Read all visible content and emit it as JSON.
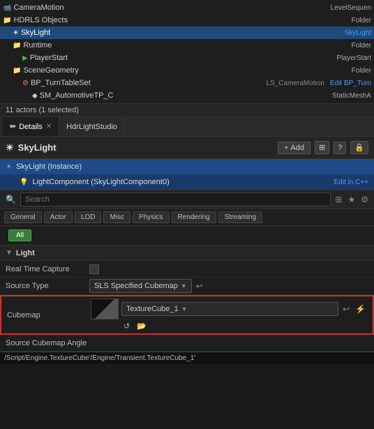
{
  "scene": {
    "items": [
      {
        "indent": 0,
        "icon": "📹",
        "label": "CameraMotion",
        "rightLabel": "LevelSequen",
        "rightClass": "",
        "selected": false
      },
      {
        "indent": 0,
        "icon": "📁",
        "label": "HDRLS Objects",
        "rightLabel": "Folder",
        "rightClass": "",
        "selected": false
      },
      {
        "indent": 1,
        "icon": "☀",
        "label": "SkyLight",
        "rightLabel": "SkyLight",
        "rightClass": "blue",
        "selected": true
      },
      {
        "indent": 1,
        "icon": "📁",
        "label": "Runtime",
        "rightLabel": "Folder",
        "rightClass": "",
        "selected": false
      },
      {
        "indent": 2,
        "icon": "▶",
        "label": "PlayerStart",
        "rightLabel": "PlayerStart",
        "rightClass": "",
        "selected": false
      },
      {
        "indent": 1,
        "icon": "📁",
        "label": "SceneGeometry",
        "rightLabel": "Folder",
        "rightClass": "",
        "selected": false
      },
      {
        "indent": 2,
        "icon": "⚙",
        "label": "BP_TurnTableSet",
        "rightLabel2": "LS_CameraMotion",
        "rightLabel": "Edit BP_Turn",
        "rightClass": "blue",
        "selected": false
      },
      {
        "indent": 3,
        "icon": "◆",
        "label": "SM_AutomotiveTP_C",
        "rightLabel": "StaticMeshA",
        "rightClass": "",
        "selected": false
      }
    ],
    "actors_count": "11 actors (1 selected)"
  },
  "tabs": [
    {
      "id": "details",
      "label": "Details",
      "icon": "✏",
      "active": true,
      "closeable": true
    },
    {
      "id": "hdrlightstudio",
      "label": "HdrLightStudio",
      "icon": "",
      "active": false,
      "closeable": false
    }
  ],
  "component": {
    "title": "SkyLight",
    "icon": "☀",
    "add_label": "+ Add",
    "actions": [
      "⊞",
      "?",
      "🔒"
    ]
  },
  "component_list": [
    {
      "icon": "☀",
      "label": "SkyLight (Instance)",
      "selected": true
    },
    {
      "icon": "💡",
      "label": "LightComponent (SkyLightComponent0)",
      "right": "Edit in C++",
      "selected": false
    }
  ],
  "search": {
    "placeholder": "Search"
  },
  "categories": [
    {
      "id": "general",
      "label": "General",
      "active": false
    },
    {
      "id": "actor",
      "label": "Actor",
      "active": false
    },
    {
      "id": "lod",
      "label": "LOD",
      "active": false
    },
    {
      "id": "misc",
      "label": "Misc",
      "active": false
    },
    {
      "id": "physics",
      "label": "Physics",
      "active": false
    },
    {
      "id": "rendering",
      "label": "Rendering",
      "active": false
    },
    {
      "id": "streaming",
      "label": "Streaming",
      "active": false
    }
  ],
  "all_label": "All",
  "sections": {
    "light": {
      "title": "Light",
      "properties": [
        {
          "id": "realtime",
          "label": "Real Time Capture",
          "type": "checkbox",
          "value": false
        },
        {
          "id": "sourcetype",
          "label": "Source Type",
          "type": "dropdown",
          "value": "SLS Specified Cubemap",
          "hasReset": true
        },
        {
          "id": "cubemap",
          "label": "Cubemap",
          "type": "cubemap",
          "value": "TextureCube_1",
          "hasReset": true,
          "highlighted": true
        }
      ]
    }
  },
  "source_cubemap_angle": {
    "label": "Source Cubemap Angle"
  },
  "path_bar": {
    "text": "/Script/Engine.TextureCube'/Engine/Transient.TextureCube_1'"
  }
}
